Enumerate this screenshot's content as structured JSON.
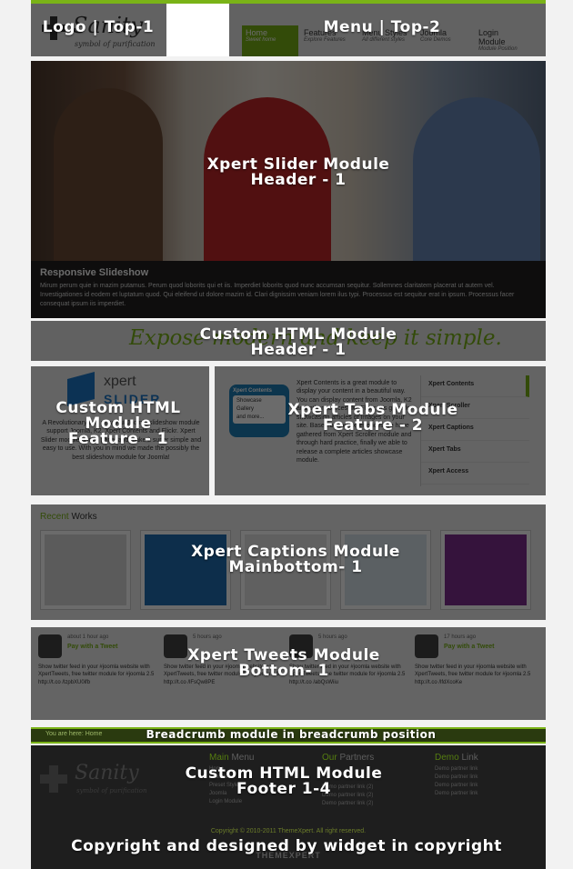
{
  "header": {
    "logo_text": "Sanity",
    "logo_tagline": "symbol of purification",
    "labels": {
      "left": "Logo | Top-1",
      "right": "Menu | Top-2"
    },
    "menu": [
      {
        "title": "Home",
        "sub": "Sweet home",
        "active": true
      },
      {
        "title": "Features",
        "sub": "Explore Features"
      },
      {
        "title": "Menu Styles",
        "sub": "All different styles"
      },
      {
        "title": "Joomla",
        "sub": "Core Demos"
      },
      {
        "title": "Login Module",
        "sub": "Module Position"
      }
    ]
  },
  "slider": {
    "label_line1": "Xpert Slider Module",
    "label_line2": "Header - 1",
    "caption_title": "Responsive Slideshow",
    "caption_text": "Mirum perum quie in mazim putamus. Perum quod loborits qui et iis. Imperdiet loborits quod nunc accumsan sequitur. Sollemnes claritatem placerat ut autem vel. Investigationes id eodem et luptatum quod. Qui eleifend ut dolore mazim id. Clari dignissim veniam lorem ilus typi. Processus est sequitur erat in ipsum. Processus facer consequat ipsum iis imperdiet."
  },
  "banner": {
    "text": "Expose modern and keep it simple.",
    "label_line1": "Custom HTML Module",
    "label_line2": "Header - 1"
  },
  "feature1": {
    "logo_text": "xpert",
    "logo_sub": "SLIDER",
    "text": "A Revolutionary and powerful Joomla slideshow module support Joomla, K2, Xpert Contents and Flickr. Xpert Slider module admin panel and make it super simple and easy to use. With you in mind we made the possibly the best slideshow module for Joomla!",
    "label_line1": "Custom HTML",
    "label_line2": "Module",
    "label_line3": "Feature - 1"
  },
  "feature2": {
    "card_title": "Xpert Contents",
    "card_items": [
      "Showcase",
      "Gallery",
      "and more..."
    ],
    "text": "Xpert Contents is a great module to display your content in a beautiful way. You can display content from Joomla, K2 and other sources like Flickr. It's great for showcasing articles or images on your site. Based on the experiences we have gathered from Xpert Scroller module and through hard practice, finally we able to release a complete articles showcase module.",
    "tabs": [
      "Xpert Contents",
      "Xpert Scroller",
      "Xpert Captions",
      "Xpert Tabs",
      "Xpert Access"
    ],
    "label_line1": "Xpert Tabs Module",
    "label_line2": "Feature - 2"
  },
  "captions": {
    "heading_accent": "Recent",
    "heading_rest": " Works",
    "label_line1": "Xpert Captions Module",
    "label_line2": "Mainbottom- 1",
    "colors": [
      "#d8d8d8",
      "#1f6fb3",
      "#e4e4e4",
      "#d9e4ec",
      "#7e2f8f"
    ]
  },
  "tweets": {
    "label_line1": "Xpert Tweets Module",
    "label_line2": "Bottom- 1",
    "items": [
      {
        "time": "about 1 hour ago",
        "author": "Pay with a Tweet",
        "text": "Show twitter feed in your #joomla website with XpertTweets, free twitter module for #joomla 2.5 http://t.co /lzpbXU0ifb"
      },
      {
        "time": "5 hours ago",
        "author": "",
        "text": "Show twitter feed in your #joomla website with XpertTweets, free twitter module for #joomla 2.5 http://t.co /lFsQw8PE"
      },
      {
        "time": "5 hours ago",
        "author": "",
        "text": "Show twitter feed in your #joomla website with XpertTweets, free twitter module for #joomla 2.5 http://t.co /abQsWiiu"
      },
      {
        "time": "17 hours ago",
        "author": "Pay with a Tweet",
        "text": "Show twitter feed in your #joomla website with XpertTweets, free twitter module for #joomla 2.5 http://t.co /lfdXcoKe"
      }
    ]
  },
  "breadcrumb": {
    "here": "You are here:",
    "home": "Home",
    "label": "Breadcrumb module in breadcrumb position"
  },
  "footer": {
    "logo_text": "Sanity",
    "logo_tagline": "symbol of purification",
    "col1_accent": "Main",
    "col1_rest": " Menu",
    "col1_items": [
      "Home",
      "Features",
      "Preset Styles",
      "Joomla",
      "Login Module"
    ],
    "col2_accent": "Our",
    "col2_rest": " Partners",
    "col2_items": [
      "Demo partner link (2)",
      "Demo partner link (2)",
      "Demo partner link (2)"
    ],
    "col3_accent": "Demo",
    "col3_rest": " Link",
    "col3_items": [
      "Demo partner link",
      "Demo partner link",
      "Demo partner link",
      "Demo partner link"
    ],
    "label_line1": "Custom HTML Module",
    "label_line2": "Footer 1-4"
  },
  "copyright": {
    "text": "Copyright © 2010-2011 ThemeXpert. All right reserved.",
    "brand": "THEMEXPERT",
    "label": "Copyright and designed by widget in copyright"
  }
}
